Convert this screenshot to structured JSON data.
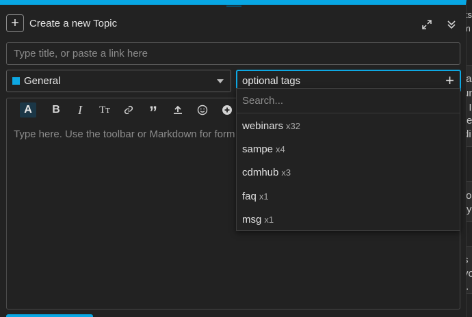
{
  "composer": {
    "header_title": "Create a new Topic",
    "title_placeholder": "Type title, or paste a link here",
    "category": {
      "label": "General",
      "color": "#0ea8e3"
    },
    "tags": {
      "label": "optional tags"
    },
    "editor": {
      "placeholder": "Type here. Use the toolbar or Markdown for form"
    },
    "toolbar": {
      "buttons": [
        "font-style",
        "bold",
        "italic",
        "heading",
        "link",
        "blockquote",
        "upload",
        "emoji",
        "more"
      ]
    },
    "accent_color": "#08a7e4"
  },
  "tag_dropdown": {
    "search_placeholder": "Search...",
    "items": [
      {
        "name": "webinars",
        "count": "x32"
      },
      {
        "name": "sampe",
        "count": "x4"
      },
      {
        "name": "cdmhub",
        "count": "x3"
      },
      {
        "name": "faq",
        "count": "x1"
      },
      {
        "name": "msg",
        "count": "x1"
      }
    ]
  },
  "background_page": {
    "snippets": [
      "its",
      "m",
      "fa",
      "un",
      ". I",
      "re",
      "di",
      "to",
      "ry",
      "s",
      "vo",
      "t."
    ]
  }
}
